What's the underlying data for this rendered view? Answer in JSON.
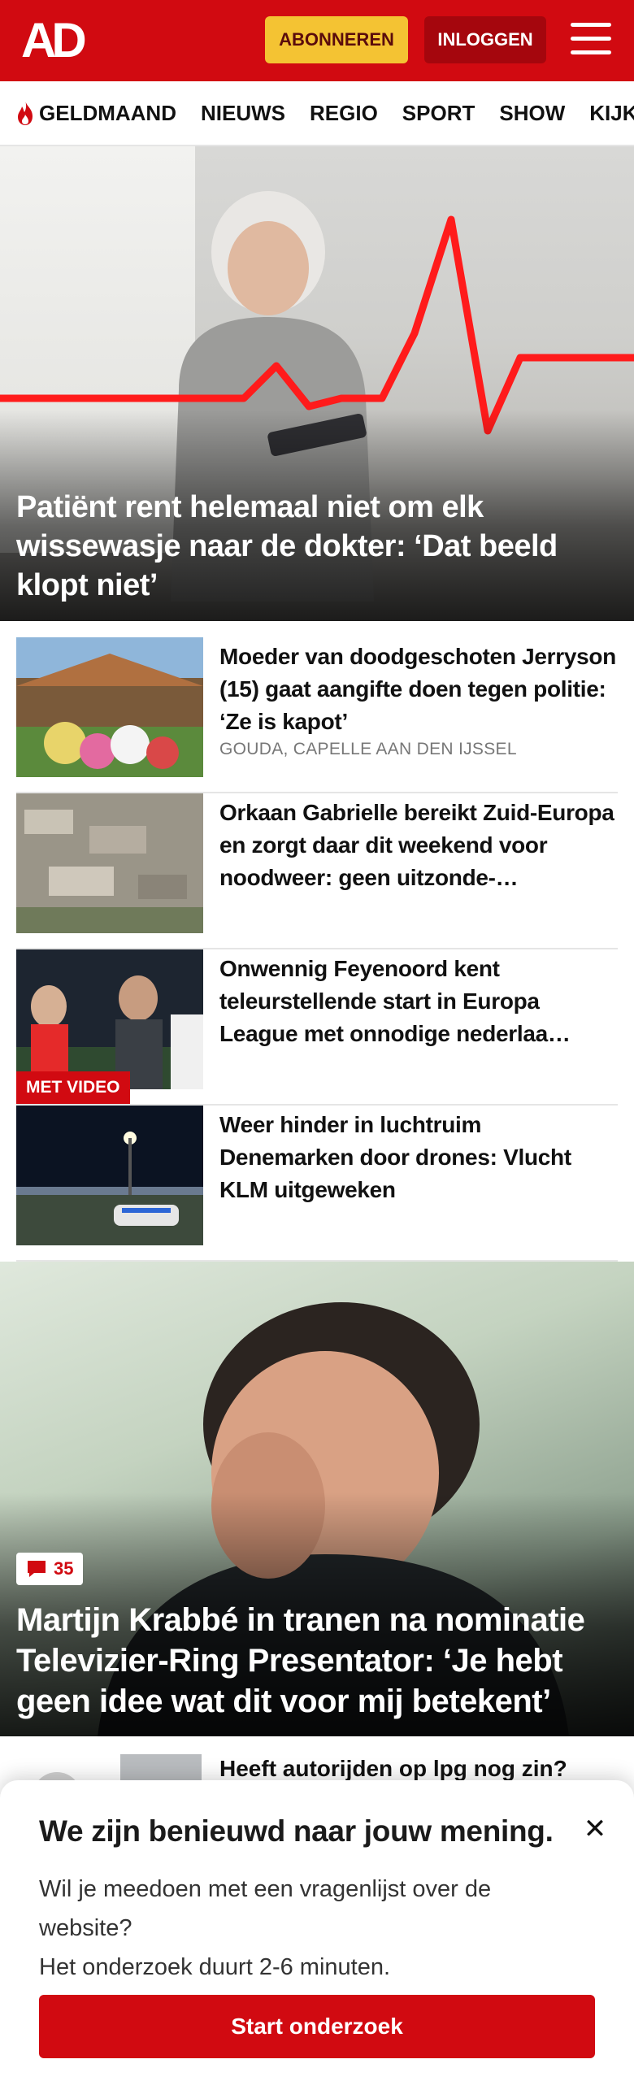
{
  "header": {
    "logo": "AD",
    "subscribe_label": "ABONNEREN",
    "login_label": "INLOGGEN"
  },
  "nav": {
    "items": [
      "GELDMAAND",
      "NIEUWS",
      "REGIO",
      "SPORT",
      "SHOW",
      "KIJK"
    ]
  },
  "hero": {
    "title": "Patiënt rent helemaal niet om elk wissewasje naar de dokter: ‘Dat beeld klopt niet’"
  },
  "articles": [
    {
      "title": "Moeder van doodgeschoten Jerryson (15) gaat aangifte doen tegen politie: ‘Ze is kapot’",
      "meta": "GOUDA, CAPELLE AAN DEN IJSSEL"
    },
    {
      "title": "Orkaan Gabrielle bereikt Zuid-Europa en zorgt daar dit weekend voor noodweer: geen uitzonde-…",
      "meta": ""
    },
    {
      "title": "Onwennig Feyenoord kent teleurstellende start in Europa League met onnodige nederlaa…",
      "meta": "",
      "badge": "MET VIDEO"
    },
    {
      "title": "Weer hinder in luchtruim Denemarken door drones: Vlucht KLM uitgeweken",
      "meta": ""
    }
  ],
  "feature": {
    "comment_count": "35",
    "title": "Martijn Krabbé in tranen na nominatie Televizier-Ring Presentator: ‘Je hebt geen idee wat dit voor mij betekent’"
  },
  "peek": {
    "title": "Heeft autorijden op lpg nog zin?"
  },
  "survey": {
    "title": "We zijn benieuwd naar jouw mening.",
    "body_line1": "Wil je meedoen met een vragenlijst over de website?",
    "body_line2": "Het onderzoek duurt 2-6 minuten.",
    "button_label": "Start onderzoek",
    "close_symbol": "✕"
  },
  "colors": {
    "brand_red": "#d10a11",
    "subscribe_yellow": "#f4c333"
  }
}
